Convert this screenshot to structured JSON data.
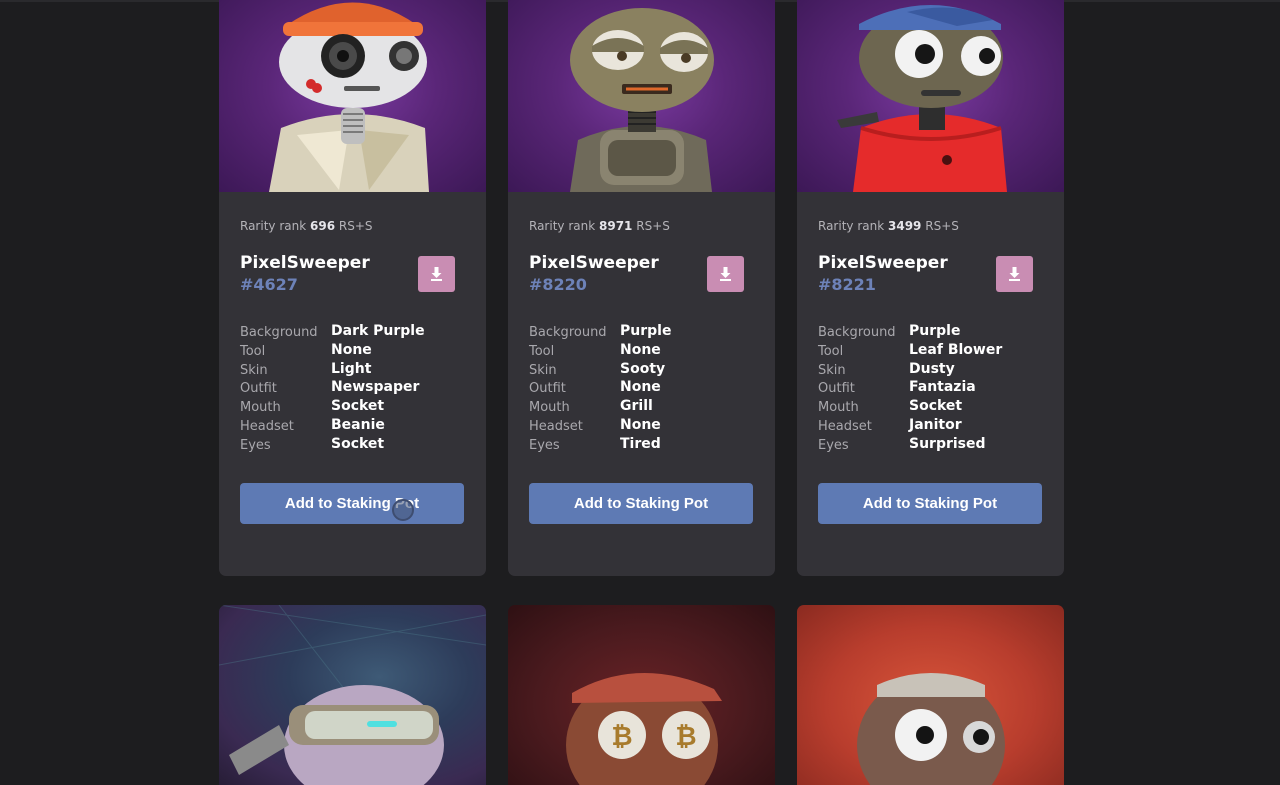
{
  "cards": [
    {
      "rank_label": "Rarity rank",
      "rank_value": "696",
      "rank_suffix": "RS+S",
      "name": "PixelSweeper",
      "number": "#4627",
      "traits": [
        {
          "key": "Background",
          "value": "Dark Purple"
        },
        {
          "key": "Tool",
          "value": "None"
        },
        {
          "key": "Skin",
          "value": "Light"
        },
        {
          "key": "Outfit",
          "value": "Newspaper"
        },
        {
          "key": "Mouth",
          "value": "Socket"
        },
        {
          "key": "Headset",
          "value": "Beanie"
        },
        {
          "key": "Eyes",
          "value": "Socket"
        }
      ],
      "button": "Add to Staking Pot"
    },
    {
      "rank_label": "Rarity rank",
      "rank_value": "8971",
      "rank_suffix": "RS+S",
      "name": "PixelSweeper",
      "number": "#8220",
      "traits": [
        {
          "key": "Background",
          "value": "Purple"
        },
        {
          "key": "Tool",
          "value": "None"
        },
        {
          "key": "Skin",
          "value": "Sooty"
        },
        {
          "key": "Outfit",
          "value": "None"
        },
        {
          "key": "Mouth",
          "value": "Grill"
        },
        {
          "key": "Headset",
          "value": "None"
        },
        {
          "key": "Eyes",
          "value": "Tired"
        }
      ],
      "button": "Add to Staking Pot"
    },
    {
      "rank_label": "Rarity rank",
      "rank_value": "3499",
      "rank_suffix": "RS+S",
      "name": "PixelSweeper",
      "number": "#8221",
      "traits": [
        {
          "key": "Background",
          "value": "Purple"
        },
        {
          "key": "Tool",
          "value": "Leaf Blower"
        },
        {
          "key": "Skin",
          "value": "Dusty"
        },
        {
          "key": "Outfit",
          "value": "Fantazia"
        },
        {
          "key": "Mouth",
          "value": "Socket"
        },
        {
          "key": "Headset",
          "value": "Janitor"
        },
        {
          "key": "Eyes",
          "value": "Surprised"
        }
      ],
      "button": "Add to Staking Pot"
    }
  ],
  "colors": {
    "page_bg": "#1d1d1f",
    "card_bg": "#333237",
    "button": "#5e7ab4",
    "download_button": "#c98db3",
    "token_number": "#6d82b8"
  },
  "icons": [
    "download-icon"
  ]
}
